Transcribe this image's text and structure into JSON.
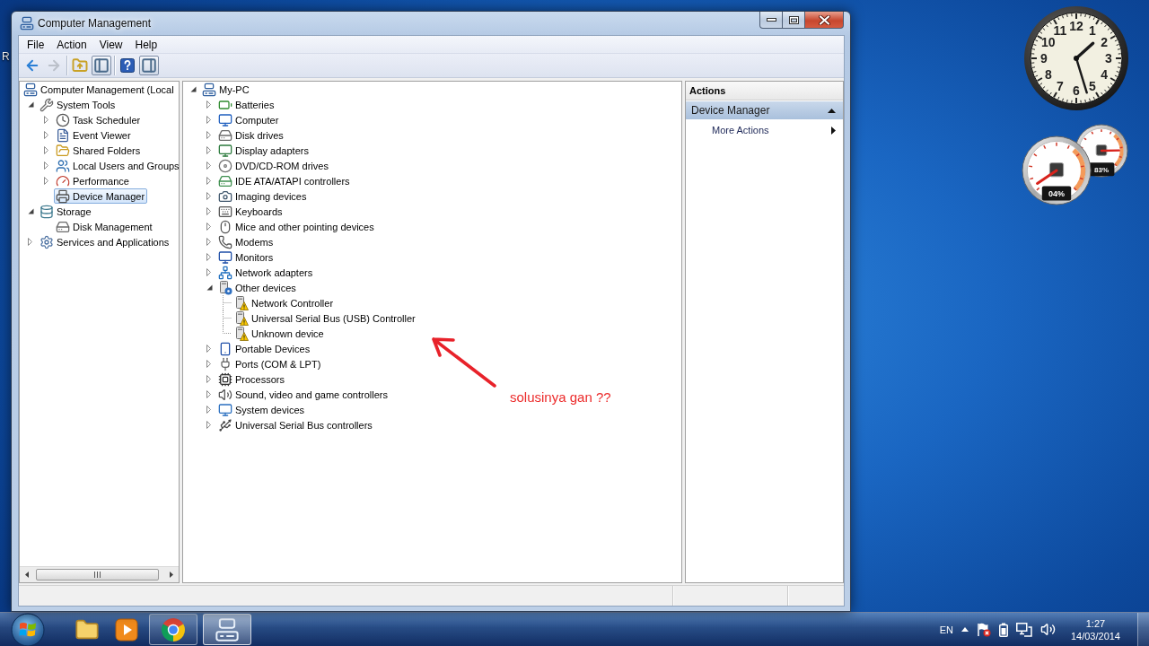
{
  "desktop": {
    "icon_labels": [
      "R"
    ]
  },
  "window": {
    "title": "Computer Management"
  },
  "menu": [
    "File",
    "Action",
    "View",
    "Help"
  ],
  "toolbar_groups": [
    [
      {
        "kind": "back",
        "disabled": false,
        "pressed": false
      },
      {
        "kind": "forward",
        "disabled": true,
        "pressed": false
      }
    ],
    [
      {
        "kind": "up",
        "disabled": false,
        "pressed": false
      },
      {
        "kind": "tree",
        "disabled": false,
        "pressed": true
      }
    ],
    [
      {
        "kind": "help",
        "disabled": false,
        "pressed": false
      },
      {
        "kind": "actions",
        "disabled": false,
        "pressed": true
      }
    ]
  ],
  "console_tree": {
    "items": [
      {
        "label": "Computer Management (Local",
        "kind": "computer",
        "selected": false,
        "children": [
          {
            "label": "System Tools",
            "kind": "tools",
            "expanded": true,
            "selected": false,
            "children": [
              {
                "label": "Task Scheduler",
                "kind": "scheduler",
                "expanded": false,
                "selected": false
              },
              {
                "label": "Event Viewer",
                "kind": "events",
                "expanded": false,
                "selected": false
              },
              {
                "label": "Shared Folders",
                "kind": "shares",
                "expanded": false,
                "selected": false
              },
              {
                "label": "Local Users and Groups",
                "kind": "users",
                "expanded": false,
                "selected": false
              },
              {
                "label": "Performance",
                "kind": "performance",
                "expanded": false,
                "selected": false
              },
              {
                "label": "Device Manager",
                "kind": "devices",
                "selected": true
              }
            ]
          },
          {
            "label": "Storage",
            "kind": "storage",
            "expanded": true,
            "selected": false,
            "children": [
              {
                "label": "Disk Management",
                "kind": "disk",
                "selected": false
              }
            ]
          },
          {
            "label": "Services and Applications",
            "kind": "services",
            "expanded": false,
            "selected": false
          }
        ]
      }
    ]
  },
  "device_tree": {
    "items": [
      {
        "label": "My-PC",
        "kind": "computer",
        "expanded": true,
        "selected": false,
        "children": [
          {
            "label": "Batteries",
            "kind": "battery",
            "expanded": false,
            "selected": false
          },
          {
            "label": "Computer",
            "kind": "pc",
            "expanded": false,
            "selected": false
          },
          {
            "label": "Disk drives",
            "kind": "disk",
            "expanded": false,
            "selected": false
          },
          {
            "label": "Display adapters",
            "kind": "display",
            "expanded": false,
            "selected": false
          },
          {
            "label": "DVD/CD-ROM drives",
            "kind": "optical",
            "expanded": false,
            "selected": false
          },
          {
            "label": "IDE ATA/ATAPI controllers",
            "kind": "controller",
            "expanded": false,
            "selected": false
          },
          {
            "label": "Imaging devices",
            "kind": "imaging",
            "expanded": false,
            "selected": false
          },
          {
            "label": "Keyboards",
            "kind": "keyboard",
            "expanded": false,
            "selected": false
          },
          {
            "label": "Mice and other pointing devices",
            "kind": "mouse",
            "expanded": false,
            "selected": false
          },
          {
            "label": "Modems",
            "kind": "modem",
            "expanded": false,
            "selected": false
          },
          {
            "label": "Monitors",
            "kind": "monitor",
            "expanded": false,
            "selected": false
          },
          {
            "label": "Network adapters",
            "kind": "network",
            "expanded": false,
            "selected": false
          },
          {
            "label": "Other devices",
            "kind": "unknown",
            "expanded": true,
            "selected": false,
            "children": [
              {
                "label": "Network Controller",
                "kind": "device",
                "warning": true,
                "selected": false
              },
              {
                "label": "Universal Serial Bus (USB) Controller",
                "kind": "device",
                "warning": true,
                "selected": false
              },
              {
                "label": "Unknown device",
                "kind": "device",
                "warning": true,
                "selected": false
              }
            ]
          },
          {
            "label": "Portable Devices",
            "kind": "portable",
            "expanded": false,
            "selected": false
          },
          {
            "label": "Ports (COM & LPT)",
            "kind": "ports",
            "expanded": false,
            "selected": false
          },
          {
            "label": "Processors",
            "kind": "processor",
            "expanded": false,
            "selected": false
          },
          {
            "label": "Sound, video and game controllers",
            "kind": "sound",
            "expanded": false,
            "selected": false
          },
          {
            "label": "System devices",
            "kind": "system",
            "expanded": false,
            "selected": false
          },
          {
            "label": "Universal Serial Bus controllers",
            "kind": "usb",
            "expanded": false,
            "selected": false
          }
        ]
      }
    ]
  },
  "actions_pane": {
    "title": "Actions",
    "sections": [
      {
        "title": "Device Manager",
        "expanded": true,
        "items": [
          {
            "label": "More Actions",
            "kind": "submenu"
          }
        ]
      }
    ]
  },
  "annotation": {
    "text": "solusinya gan ??"
  },
  "gadgets": {
    "clock": {
      "numerals": [
        "11",
        "12",
        "1",
        "10",
        "2",
        "9",
        "3",
        "8",
        "4",
        "7",
        "6",
        "5"
      ]
    },
    "cpu_meter": {
      "cpu_reading": "04%",
      "memory_reading": "83%"
    }
  },
  "taskbar": {
    "buttons": [
      {
        "kind": "explorer",
        "running": false,
        "selected": false
      },
      {
        "kind": "media",
        "running": false,
        "selected": false
      },
      {
        "kind": "browser",
        "running": true,
        "selected": false
      },
      {
        "kind": "computer",
        "running": true,
        "selected": true
      }
    ],
    "tray": {
      "language": "EN",
      "time": "1:27",
      "date": "14/03/2014"
    }
  }
}
